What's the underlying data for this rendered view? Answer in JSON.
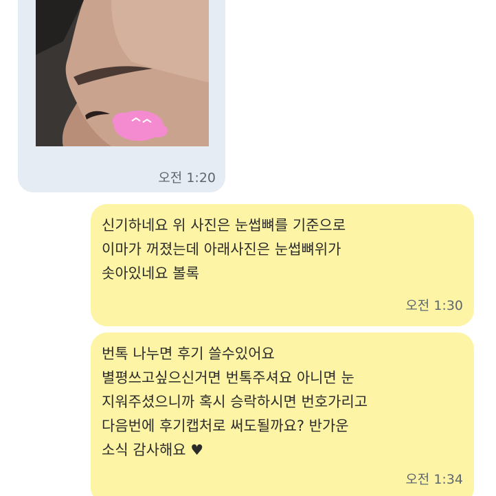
{
  "messages": [
    {
      "id": "m1",
      "side": "incoming",
      "type": "photo",
      "photo_description": "profile-face-photo",
      "time": "오전 1:20"
    },
    {
      "id": "m2",
      "side": "outgoing",
      "text": "신기하네요 위 사진은 눈썹뼈를 기준으로\n이마가 꺼졌는데 아래사진은 눈썹뼈위가\n솟아있네요 볼록",
      "time": "오전 1:30"
    },
    {
      "id": "m3",
      "side": "outgoing",
      "text": "번톡 나누면 후기 쓸수있어요\n별평쓰고싶으신거면 번톡주셔요 아니면  눈\n지워주셨으니까  혹시 승락하시면 번호가리고\n다음번에 후기캡처로 써도될까요? 반가운\n소식 감사해요 ♥",
      "time": "오전 1:34"
    }
  ],
  "colors": {
    "incoming_bubble": "#e6ecf3",
    "outgoing_bubble": "#fdf5a5",
    "timestamp": "#5d6670",
    "text": "#2b2b2b"
  }
}
